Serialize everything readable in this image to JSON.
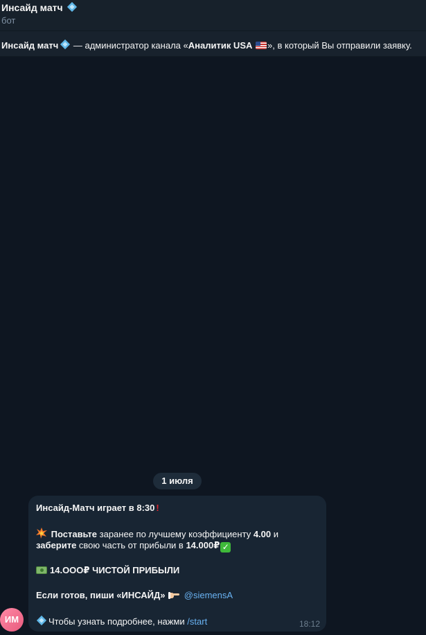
{
  "header": {
    "title": "Инсайд матч",
    "subtitle": "бот"
  },
  "notice": {
    "sender": "Инсайд матч",
    "text_before": " — администратор канала «",
    "channel": "Аналитик USA",
    "text_after": "», в который Вы отправили заявку."
  },
  "chat": {
    "date_separator": "1 июля",
    "message": {
      "line1": "Инсайд-Матч играет в 8:30",
      "line2_bold1": "Поставьте",
      "line2_text": " заранее по лучшему коэффициенту ",
      "line2_bold2": "4.00",
      "line2_end": " и",
      "line3_bold1": "заберите",
      "line3_text": " свою часть от прибыли в ",
      "line3_bold2": "14.000₽",
      "line4": "14.OOO₽ ЧИСТОЙ ПРИБЫЛИ",
      "line5_bold": "Если готов, пиши «ИНСАЙД»",
      "line5_mention": "@siemensA",
      "line6_text": "Чтобы узнать подробнее, нажми ",
      "line6_command": "/start",
      "time": "18:12"
    },
    "avatar_initials": "ИМ"
  },
  "icons": {
    "diamond": "diamond-icon",
    "flag": "us-flag-icon",
    "collision": "collision-icon",
    "check": "check-mark-icon",
    "money": "banknote-icon",
    "pointing": "pointing-hand-icon",
    "exclamation": "exclamation-icon"
  },
  "colors": {
    "background": "#0e1621",
    "header": "#17212b",
    "bubble": "#182533",
    "link": "#6ab3f3",
    "avatar": "#e85a7d"
  }
}
